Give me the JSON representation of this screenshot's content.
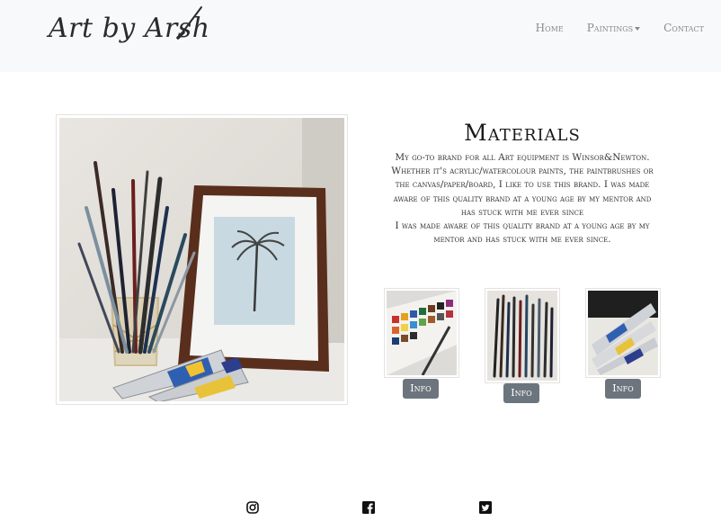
{
  "brand": {
    "logo_text": "Art by Arsh"
  },
  "nav": {
    "home": "Home",
    "paintings": "Paintings",
    "contact": "Contact"
  },
  "main": {
    "title": "Materials",
    "description_lines": [
      "My go-to brand for all Art equipment is Winsor&Newton.",
      "Whether it's acrylic/watercolour paints, the paintbrushes or",
      "the canvas/paper/board, I like to use this brand. I was made",
      "aware of this quality brand at a young age by my mentor and",
      "has stuck with me ever since",
      "I was made aware of this quality brand at a young age by my",
      "mentor and has stuck with me ever since."
    ]
  },
  "thumbnails": [
    {
      "button_label": "Info",
      "icon": "watercolour-palette"
    },
    {
      "button_label": "Info",
      "icon": "paintbrushes"
    },
    {
      "button_label": "Info",
      "icon": "paint-tubes"
    }
  ],
  "social": {
    "instagram": "instagram-icon",
    "facebook": "facebook-icon",
    "twitter": "twitter-icon"
  },
  "colors": {
    "header_bg": "#f8f9fa",
    "nav_text": "#8a8a8a",
    "button_bg": "#6c757d",
    "button_text": "#ffffff"
  }
}
